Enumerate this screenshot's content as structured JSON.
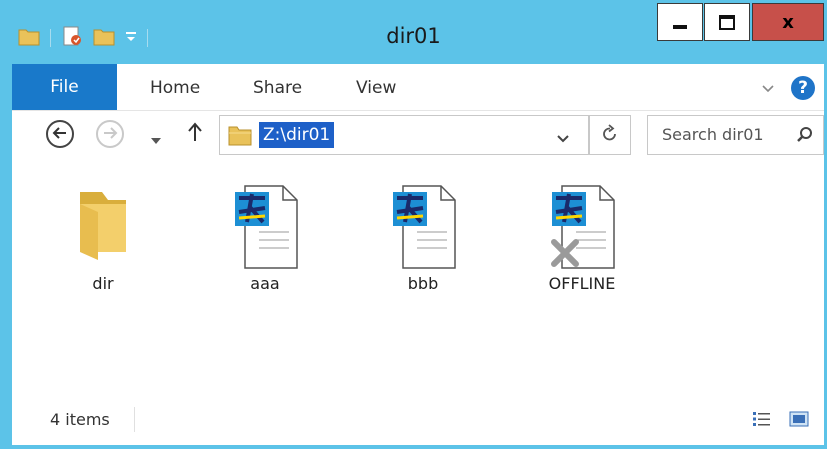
{
  "window": {
    "title": "dir01",
    "close_label": "x",
    "frame_color": "#5cc3e8"
  },
  "quick_access": {
    "icons": [
      "folder-icon",
      "properties-icon",
      "new-folder-icon",
      "customize-dropdown-icon"
    ]
  },
  "ribbon": {
    "tabs": [
      "File",
      "Home",
      "Share",
      "View"
    ],
    "file_tab_color": "#1979ca",
    "expand_icon": "chevron-down-icon",
    "help_label": "?"
  },
  "navigation": {
    "back_icon": "back-arrow-icon",
    "forward_icon": "forward-arrow-icon",
    "recent_icon": "chevron-down-icon",
    "up_icon": "up-arrow-icon"
  },
  "address_bar": {
    "value": "Z:\\dir01",
    "refresh_icon": "refresh-icon"
  },
  "search": {
    "placeholder": "Search dir01",
    "icon": "search-icon"
  },
  "files": [
    {
      "name": "dir",
      "type": "folder"
    },
    {
      "name": "aaa",
      "type": "document"
    },
    {
      "name": "bbb",
      "type": "document"
    },
    {
      "name": "OFFLINE",
      "type": "document-offline"
    }
  ],
  "status_bar": {
    "item_count": "4 items",
    "view_icons": [
      "details-view-icon",
      "large-icons-view-icon"
    ]
  }
}
